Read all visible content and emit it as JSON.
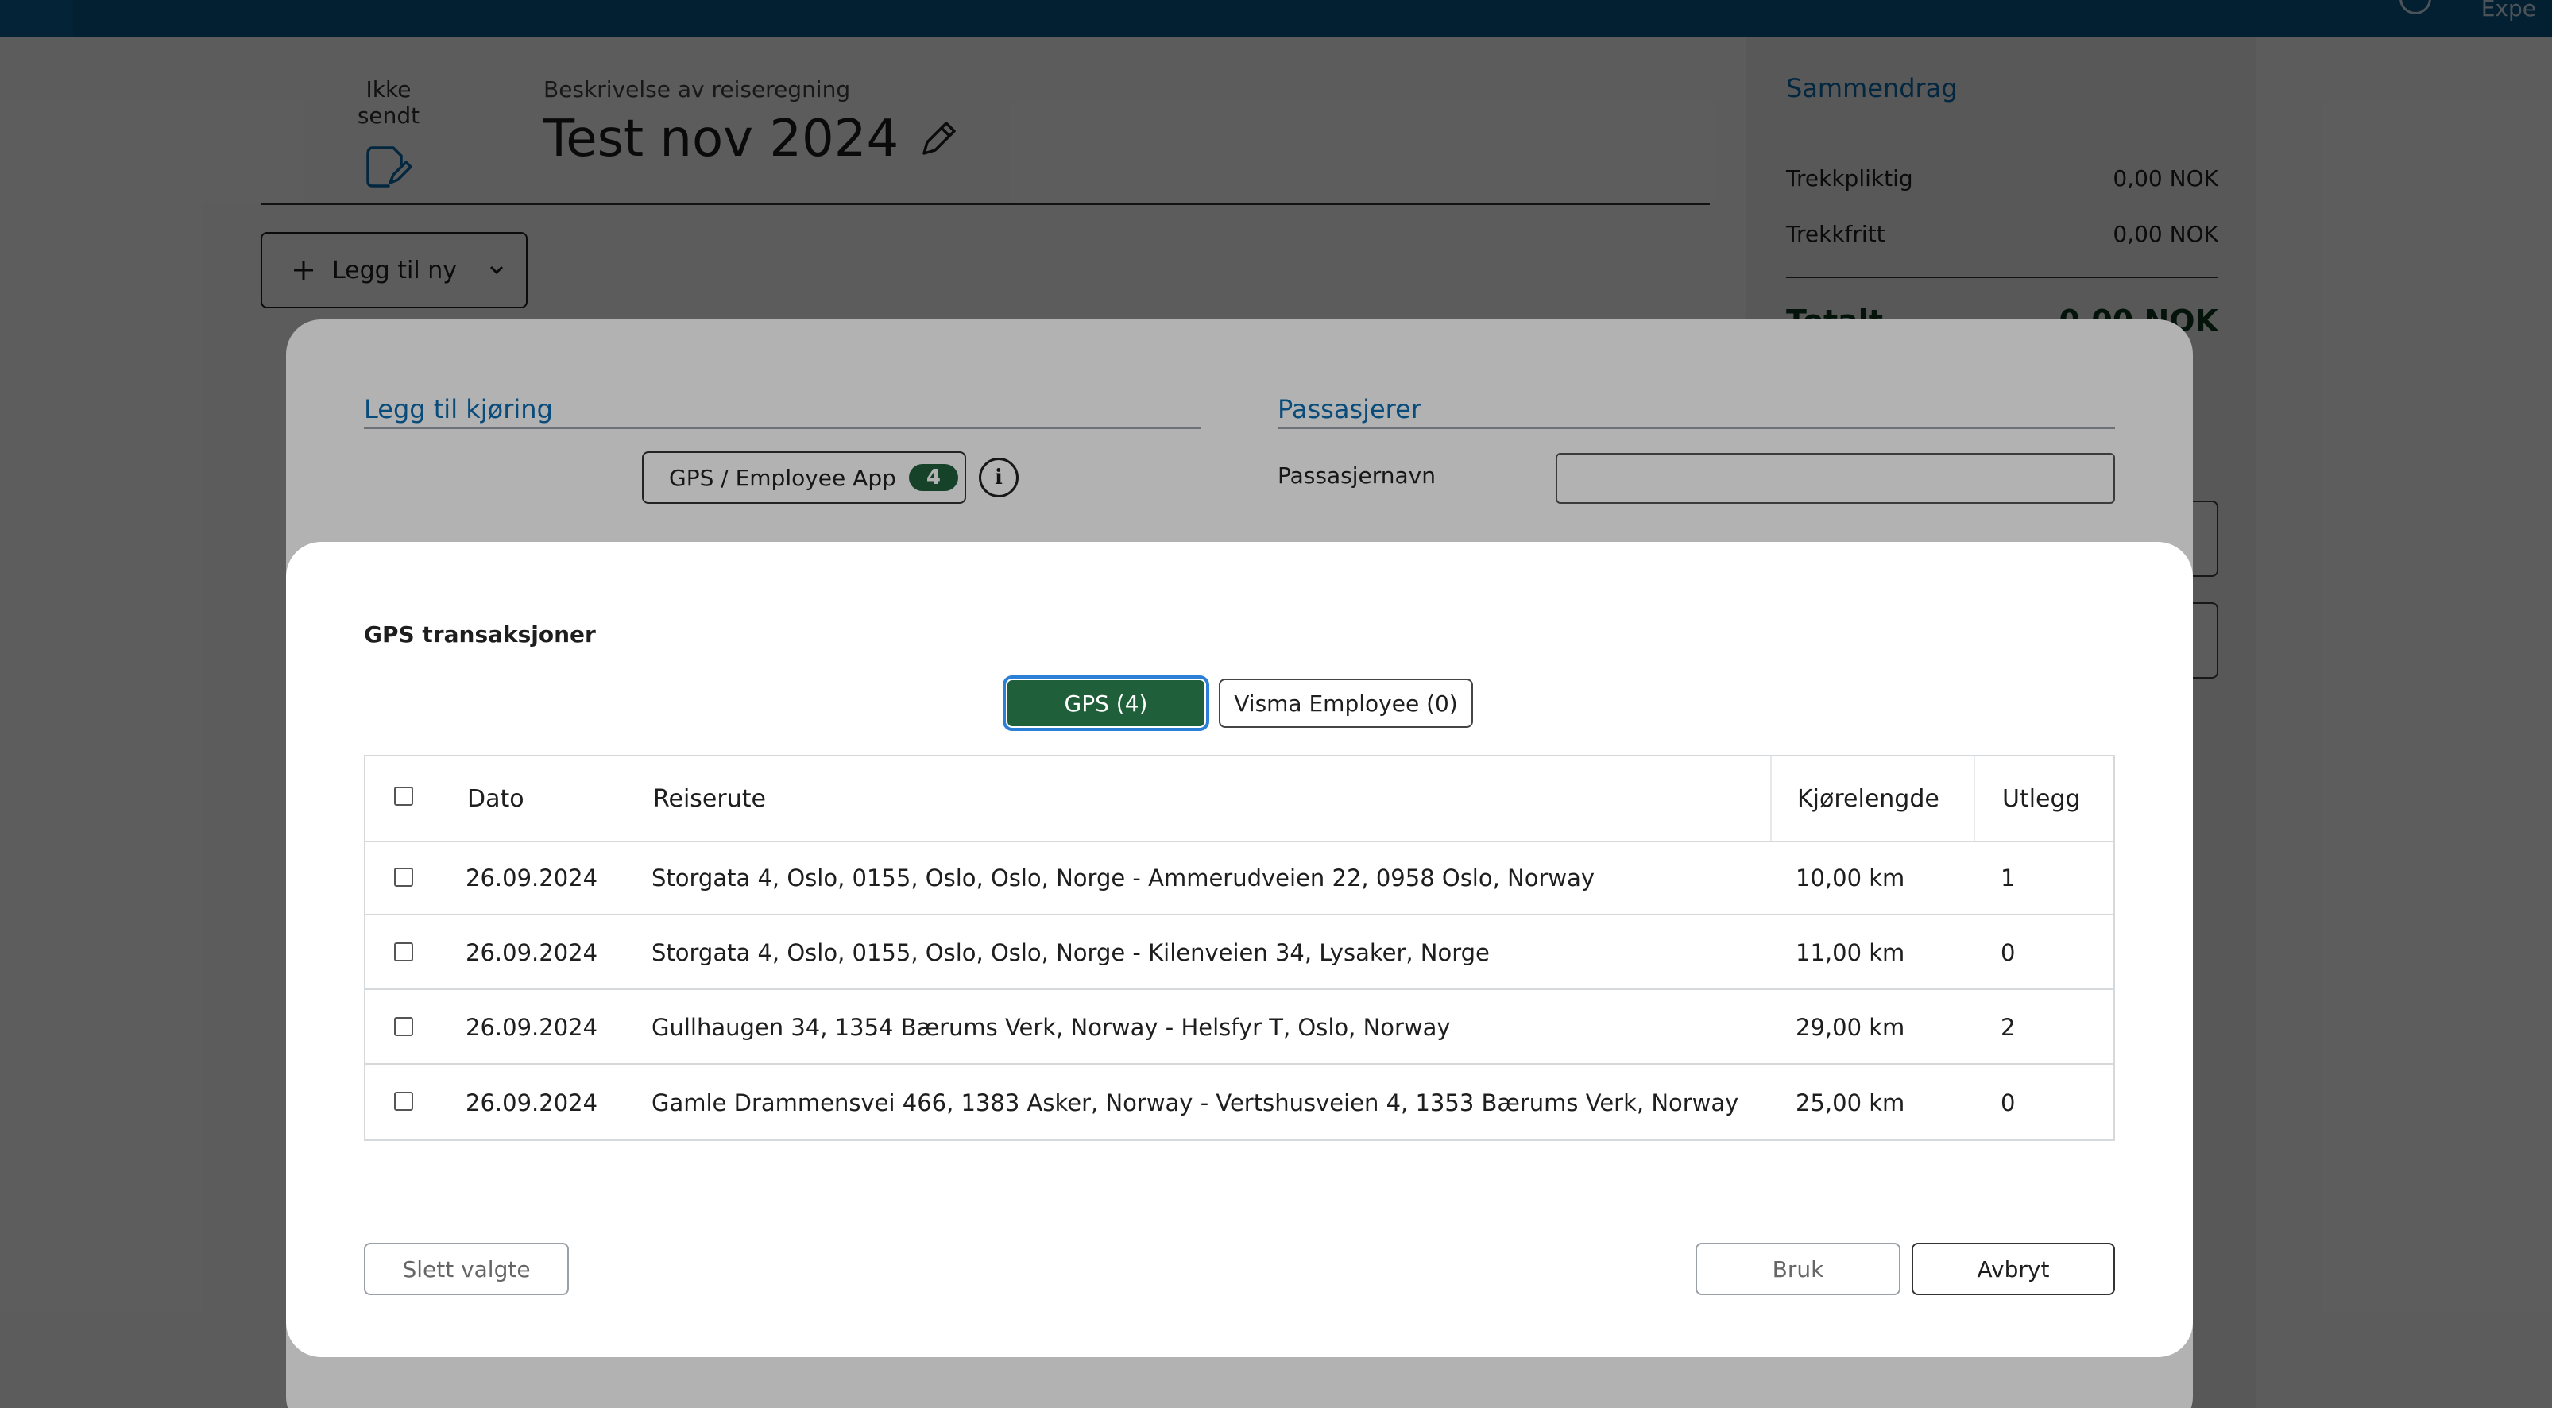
{
  "topbar": {
    "user_text": "Expe"
  },
  "header": {
    "status_label": "Ikke sendt",
    "description_label": "Beskrivelse av reiseregning",
    "title": "Test nov 2024"
  },
  "toolbar": {
    "add_new_label": "Legg til ny"
  },
  "summary": {
    "title": "Sammendrag",
    "rows": [
      {
        "label": "Trekkpliktig",
        "value": "0,00 NOK"
      },
      {
        "label": "Trekkfritt",
        "value": "0,00 NOK"
      }
    ],
    "total_label": "Totalt",
    "total_value": "0,00 NOK"
  },
  "driving_dialog": {
    "section_title": "Legg til kjøring",
    "gps_button_label": "GPS / Employee App",
    "gps_count": "4",
    "info_icon_glyph": "i",
    "passengers_title": "Passasjerer",
    "passenger_name_label": "Passasjernavn",
    "passenger_name_value": ""
  },
  "modal": {
    "title": "GPS transaksjoner",
    "tabs": [
      {
        "label": "GPS (4)",
        "active": true
      },
      {
        "label": "Visma Employee (0)",
        "active": false
      }
    ],
    "table": {
      "columns": [
        "Dato",
        "Reiserute",
        "Kjørelengde",
        "Utlegg"
      ],
      "rows": [
        {
          "date": "26.09.2024",
          "route": "Storgata 4, Oslo, 0155, Oslo, Oslo, Norge - Ammerudveien 22, 0958 Oslo, Norway",
          "distance": "10,00 km",
          "expenses": "1"
        },
        {
          "date": "26.09.2024",
          "route": "Storgata 4, Oslo, 0155, Oslo, Oslo, Norge - Kilenveien 34, Lysaker, Norge",
          "distance": "11,00 km",
          "expenses": "0"
        },
        {
          "date": "26.09.2024",
          "route": "Gullhaugen 34, 1354 Bærums Verk, Norway - Helsfyr T, Oslo, Norway",
          "distance": "29,00 km",
          "expenses": "2"
        },
        {
          "date": "26.09.2024",
          "route": "Gamle Drammensvei 466, 1383 Asker, Norway - Vertshusveien 4, 1353 Bærums Verk, Norway",
          "distance": "25,00 km",
          "expenses": "0"
        }
      ]
    },
    "buttons": {
      "delete_selected": "Slett valgte",
      "use": "Bruk",
      "cancel": "Avbryt"
    }
  },
  "colors": {
    "topbar": "#0b5a8a",
    "link_blue": "#0d6eb0",
    "accent_green": "#1f5f3a",
    "focus_ring": "#2b7fd6"
  },
  "icons": {
    "status": "document-edit-icon",
    "edit": "pencil-icon",
    "add": "plus-icon",
    "dropdown": "chevron-down-icon",
    "info": "info-icon"
  }
}
